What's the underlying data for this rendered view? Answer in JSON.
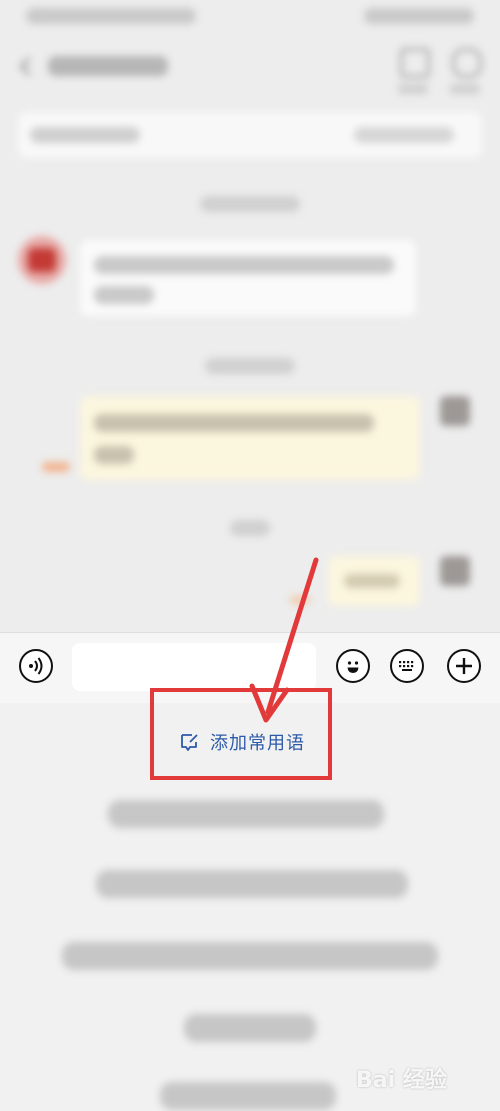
{
  "input_bar": {
    "voice_icon": "voice-icon",
    "emoji_icon": "emoji-icon",
    "keyboard_icon": "keyboard-icon",
    "plus_icon": "plus-icon",
    "text_value": ""
  },
  "quick_replies": {
    "add_label": "添加常用语",
    "add_icon": "edit-icon"
  },
  "annotation": {
    "color": "#e23a3a"
  },
  "watermark": {
    "text": "Bai 经验"
  },
  "colors": {
    "link_blue": "#2d5aa8",
    "background": "#ededed"
  }
}
